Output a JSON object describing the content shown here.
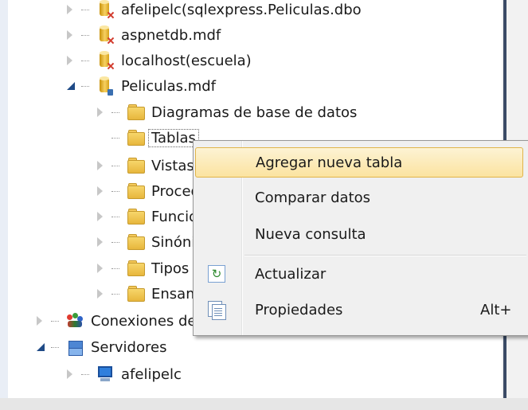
{
  "tree": {
    "items": [
      {
        "label": "afelipelc(sqlexpress.Peliculas.dbo",
        "icon": "database-disconnected-icon"
      },
      {
        "label": "aspnetdb.mdf",
        "icon": "database-disconnected-icon"
      },
      {
        "label": "localhost(escuela)",
        "icon": "database-disconnected-icon"
      },
      {
        "label": "Peliculas.mdf",
        "icon": "database-connected-icon"
      },
      {
        "label": "Diagramas de base de datos",
        "icon": "folder-icon"
      },
      {
        "label": "Tablas",
        "icon": "folder-icon"
      },
      {
        "label": "Vistas",
        "icon": "folder-icon"
      },
      {
        "label": "Procedimientos almacenados",
        "icon": "folder-icon"
      },
      {
        "label": "Funciones",
        "icon": "folder-icon"
      },
      {
        "label": "Sinónimos",
        "icon": "folder-icon"
      },
      {
        "label": "Tipos",
        "icon": "folder-icon"
      },
      {
        "label": "Ensamblados",
        "icon": "folder-icon"
      },
      {
        "label": "Conexiones de datos",
        "icon": "data-connections-icon"
      },
      {
        "label": "Servidores",
        "icon": "servers-icon"
      },
      {
        "label": "afelipelc",
        "icon": "computer-icon"
      }
    ]
  },
  "context_menu": {
    "items": [
      {
        "label": "Agregar nueva tabla",
        "highlighted": true
      },
      {
        "label": "Comparar datos"
      },
      {
        "label": "Nueva consulta"
      },
      {
        "label": "Actualizar",
        "icon": "refresh-icon"
      },
      {
        "label": "Propiedades",
        "shortcut": "Alt+",
        "icon": "properties-icon"
      }
    ]
  },
  "colors": {
    "menu_highlight": "#fbe3a0",
    "menu_background": "#f0f0f0",
    "tree_background": "#ffffff"
  }
}
